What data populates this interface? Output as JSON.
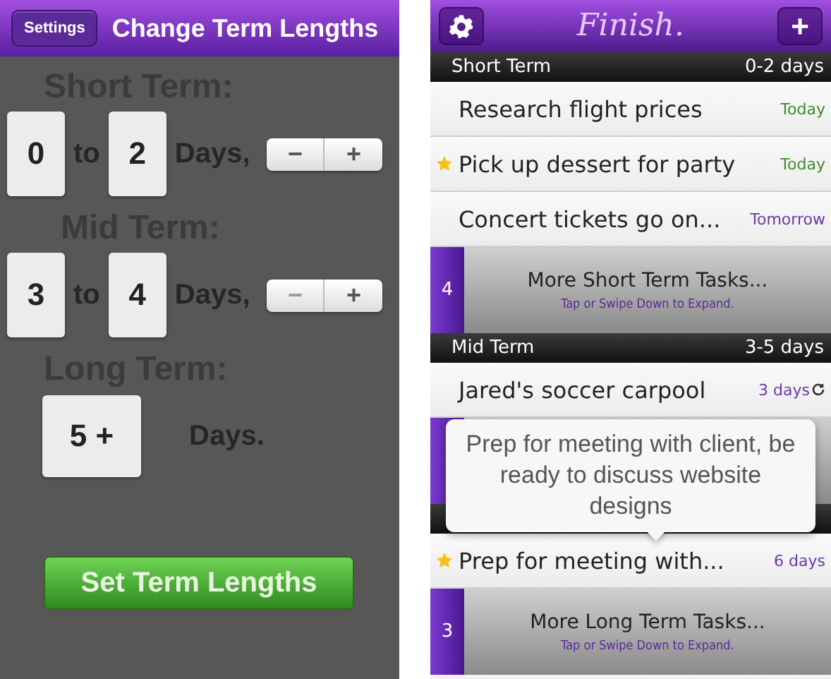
{
  "settings_screen": {
    "back_button": "Settings",
    "title": "Change Term Lengths",
    "terms": [
      {
        "kind": "range",
        "label": "Short Term:",
        "from": "0",
        "joiner": "to",
        "to": "2",
        "unit": "Days,",
        "minus": "−",
        "plus": "+",
        "minus_disabled": false
      },
      {
        "kind": "range",
        "label": "Mid Term:",
        "from": "3",
        "joiner": "to",
        "to": "4",
        "unit": "Days,",
        "minus": "−",
        "plus": "+",
        "minus_disabled": true
      },
      {
        "kind": "open",
        "label": "Long Term:",
        "from": "5 +",
        "unit": "Days."
      }
    ],
    "submit_button": "Set Term Lengths"
  },
  "list_screen": {
    "title": "Finish.",
    "add_button": "+",
    "items": [
      {
        "kind": "section",
        "name": "Short Term",
        "range": "0-2 days"
      },
      {
        "kind": "task",
        "title": "Research flight prices",
        "due": "Today",
        "color": "#3e8a2a",
        "starred": false,
        "repeating": false
      },
      {
        "kind": "task",
        "title": "Pick up dessert for party",
        "due": "Today",
        "color": "#3e8a2a",
        "starred": true,
        "repeating": false
      },
      {
        "kind": "task",
        "title": "Concert tickets go on...",
        "due": "Tomorrow",
        "color": "#6a3aa8",
        "starred": false,
        "repeating": false
      },
      {
        "kind": "more",
        "count": "4",
        "title": "More Short Term Tasks...",
        "hint": "Tap or Swipe Down to Expand."
      },
      {
        "kind": "section",
        "name": "Mid Term",
        "range": "3-5 days"
      },
      {
        "kind": "task",
        "title": "Jared's soccer carpool",
        "due": "3 days",
        "color": "#6a3aa8",
        "starred": false,
        "repeating": true
      },
      {
        "kind": "more"
      },
      {
        "kind": "section"
      },
      {
        "kind": "task",
        "title": "Prep for meeting with...",
        "due": "6 days",
        "color": "#6a3aa8",
        "starred": true,
        "repeating": false
      },
      {
        "kind": "more",
        "count": "3",
        "title": "More Long Term Tasks...",
        "hint": "Tap or Swipe Down to Expand."
      }
    ],
    "tooltip": "Prep for meeting with client, be ready to discuss website designs"
  }
}
